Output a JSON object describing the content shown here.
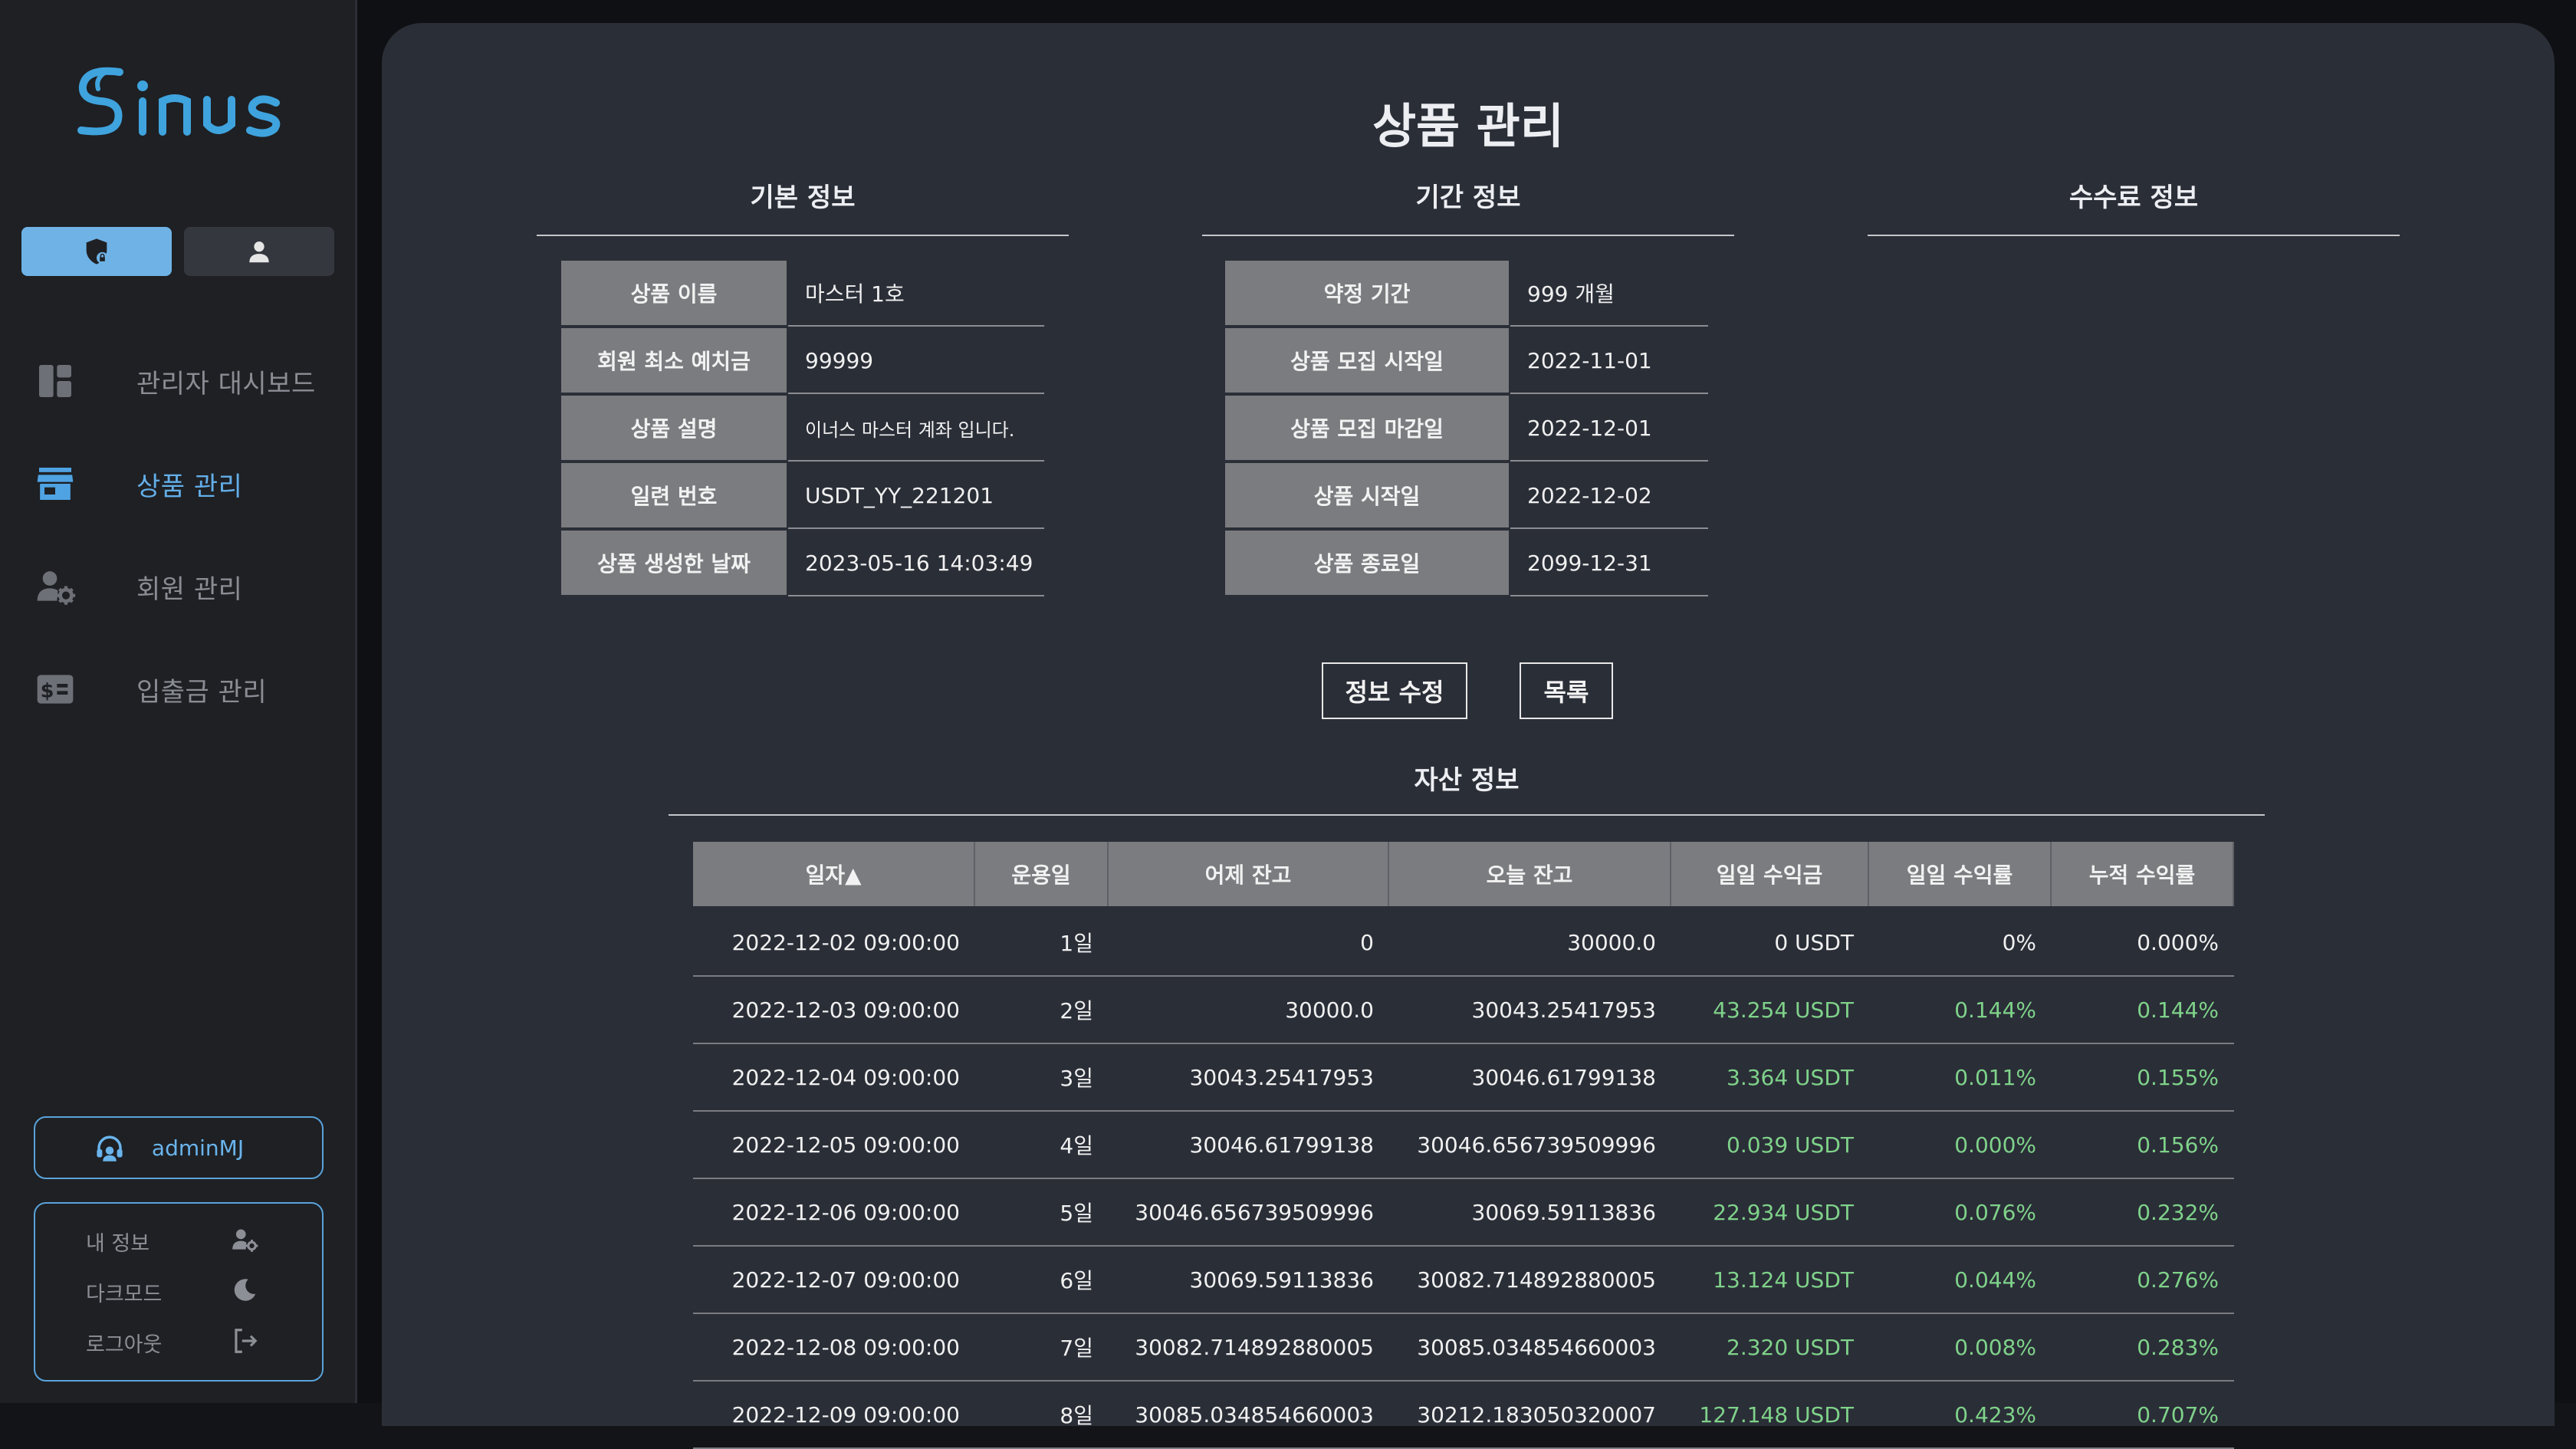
{
  "sidebar": {
    "logo_text": "Sinus",
    "role_tabs": [
      {
        "name": "admin-role",
        "icon": "shield-lock-icon"
      },
      {
        "name": "user-role",
        "icon": "person-icon"
      }
    ],
    "nav": [
      {
        "label": "관리자 대시보드",
        "icon": "dashboard-icon",
        "active": false
      },
      {
        "label": "상품 관리",
        "icon": "store-icon",
        "active": true
      },
      {
        "label": "회원 관리",
        "icon": "user-gear-icon",
        "active": false
      },
      {
        "label": "입출금 관리",
        "icon": "money-icon",
        "active": false
      }
    ],
    "user": {
      "name": "adminMJ",
      "icon": "support-headset-icon"
    },
    "menu": [
      {
        "label": "내 정보",
        "icon": "user-gear-icon"
      },
      {
        "label": "다크모드",
        "icon": "moon-icon"
      },
      {
        "label": "로그아웃",
        "icon": "logout-icon"
      }
    ]
  },
  "main": {
    "title": "상품 관리",
    "sections": {
      "basic": "기본 정보",
      "period": "기간 정보",
      "fee": "수수료 정보",
      "asset": "자산 정보"
    },
    "basic_info": [
      {
        "key": "상품 이름",
        "value": "마스터 1호"
      },
      {
        "key": "회원 최소 예치금",
        "value": "99999"
      },
      {
        "key": "상품 설명",
        "value": "이너스 마스터 계좌 입니다."
      },
      {
        "key": "일련 번호",
        "value": "USDT_YY_221201"
      },
      {
        "key": "상품 생성한 날짜",
        "value": "2023-05-16 14:03:49"
      }
    ],
    "period_info": [
      {
        "key": "약정 기간",
        "value": "999 개월"
      },
      {
        "key": "상품 모집 시작일",
        "value": "2022-11-01"
      },
      {
        "key": "상품 모집 마감일",
        "value": "2022-12-01"
      },
      {
        "key": "상품 시작일",
        "value": "2022-12-02"
      },
      {
        "key": "상품 종료일",
        "value": "2099-12-31"
      }
    ],
    "buttons": {
      "edit": "정보 수정",
      "list": "목록"
    },
    "asset_table": {
      "headers": [
        "일자▲",
        "운용일",
        "어제 잔고",
        "오늘 잔고",
        "일일 수익금",
        "일일 수익률",
        "누적 수익률"
      ],
      "rows": [
        [
          "2022-12-02 09:00:00",
          "1일",
          "0",
          "30000.0",
          "0 USDT",
          "0%",
          "0.000%"
        ],
        [
          "2022-12-03 09:00:00",
          "2일",
          "30000.0",
          "30043.25417953",
          "43.254 USDT",
          "0.144%",
          "0.144%"
        ],
        [
          "2022-12-04 09:00:00",
          "3일",
          "30043.25417953",
          "30046.61799138",
          "3.364 USDT",
          "0.011%",
          "0.155%"
        ],
        [
          "2022-12-05 09:00:00",
          "4일",
          "30046.61799138",
          "30046.656739509996",
          "0.039 USDT",
          "0.000%",
          "0.156%"
        ],
        [
          "2022-12-06 09:00:00",
          "5일",
          "30046.656739509996",
          "30069.59113836",
          "22.934 USDT",
          "0.076%",
          "0.232%"
        ],
        [
          "2022-12-07 09:00:00",
          "6일",
          "30069.59113836",
          "30082.714892880005",
          "13.124 USDT",
          "0.044%",
          "0.276%"
        ],
        [
          "2022-12-08 09:00:00",
          "7일",
          "30082.714892880005",
          "30085.034854660003",
          "2.320 USDT",
          "0.008%",
          "0.283%"
        ],
        [
          "2022-12-09 09:00:00",
          "8일",
          "30085.034854660003",
          "30212.183050320007",
          "127.148 USDT",
          "0.423%",
          "0.707%"
        ]
      ],
      "green_from_row": 1,
      "green_cols": [
        4,
        5,
        6
      ]
    }
  },
  "colors": {
    "accent": "#63aee8",
    "positive": "#7fd28a",
    "header_cell": "#7b7c80",
    "panel": "#2a2e37",
    "sidebar": "#1e2024"
  }
}
